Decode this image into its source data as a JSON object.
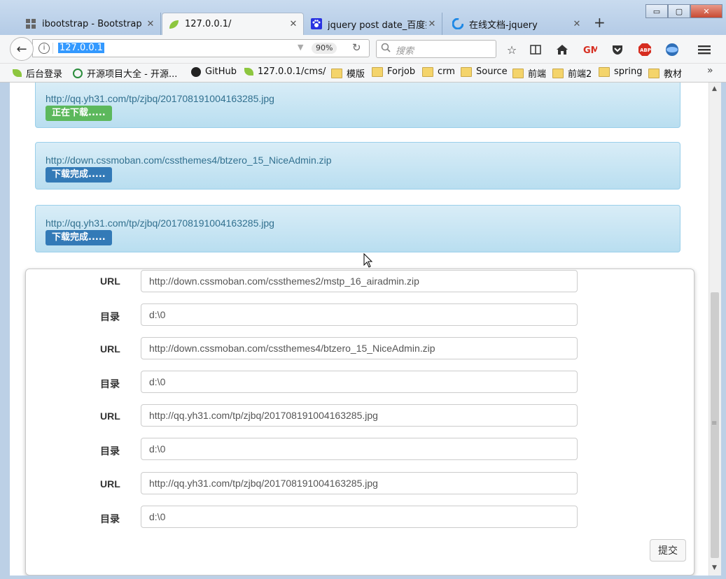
{
  "window": {
    "minimize_glyph": "▭",
    "maximize_glyph": "▢",
    "close_glyph": "✕"
  },
  "tabs": [
    {
      "title": "ibootstrap - Bootstrap",
      "icon": "grid-icon",
      "active": false
    },
    {
      "title": "127.0.0.1/",
      "icon": "leaf-icon",
      "active": true
    },
    {
      "title": "jquery post date_百度搜",
      "icon": "baidu-paw-icon",
      "active": false
    },
    {
      "title": "在线文档-jquery",
      "icon": "c-logo-icon",
      "active": false
    }
  ],
  "tab_close_glyph": "✕",
  "new_tab_glyph": "+",
  "navbar": {
    "back_glyph": "←",
    "url": "127.0.0.1",
    "zoom": "90%",
    "search_placeholder": "搜索"
  },
  "bookmarks": [
    {
      "label": "后台登录",
      "icon": "leaf"
    },
    {
      "label": "开源项目大全 - 开源...",
      "icon": "kyc"
    },
    {
      "label": "GitHub",
      "icon": "github"
    },
    {
      "label": "127.0.0.1/cms/",
      "icon": "leaf"
    },
    {
      "label": "模版",
      "icon": "folder"
    },
    {
      "label": "Forjob",
      "icon": "folder"
    },
    {
      "label": "crm",
      "icon": "folder"
    },
    {
      "label": "Source",
      "icon": "folder"
    },
    {
      "label": "前端",
      "icon": "folder"
    },
    {
      "label": "前端2",
      "icon": "folder"
    },
    {
      "label": "spring",
      "icon": "folder"
    },
    {
      "label": "教材",
      "icon": "folder"
    }
  ],
  "bookmarks_more": "»",
  "downloads": [
    {
      "url": "http://qq.yh31.com/tp/zjbq/201708191004163285.jpg",
      "status": "正在下载.....",
      "state": "downloading"
    },
    {
      "url": "http://down.cssmoban.com/cssthemes4/btzero_15_NiceAdmin.zip",
      "status": "下载完成.....",
      "state": "done"
    },
    {
      "url": "http://qq.yh31.com/tp/zjbq/201708191004163285.jpg",
      "status": "下载完成.....",
      "state": "done"
    }
  ],
  "form": {
    "rows": [
      {
        "label": "URL",
        "value": "http://down.cssmoban.com/cssthemes2/mstp_16_airadmin.zip"
      },
      {
        "label": "目录",
        "value": "d:\\0"
      },
      {
        "label": "URL",
        "value": "http://down.cssmoban.com/cssthemes4/btzero_15_NiceAdmin.zip"
      },
      {
        "label": "目录",
        "value": "d:\\0"
      },
      {
        "label": "URL",
        "value": "http://qq.yh31.com/tp/zjbq/201708191004163285.jpg"
      },
      {
        "label": "目录",
        "value": "d:\\0"
      },
      {
        "label": "URL",
        "value": "http://qq.yh31.com/tp/zjbq/201708191004163285.jpg"
      },
      {
        "label": "目录",
        "value": "d:\\0"
      }
    ],
    "submit_label": "提交"
  },
  "colors": {
    "downloading": "#5cb85c",
    "done": "#337ab7",
    "alert_bg": "#d9edf7"
  }
}
